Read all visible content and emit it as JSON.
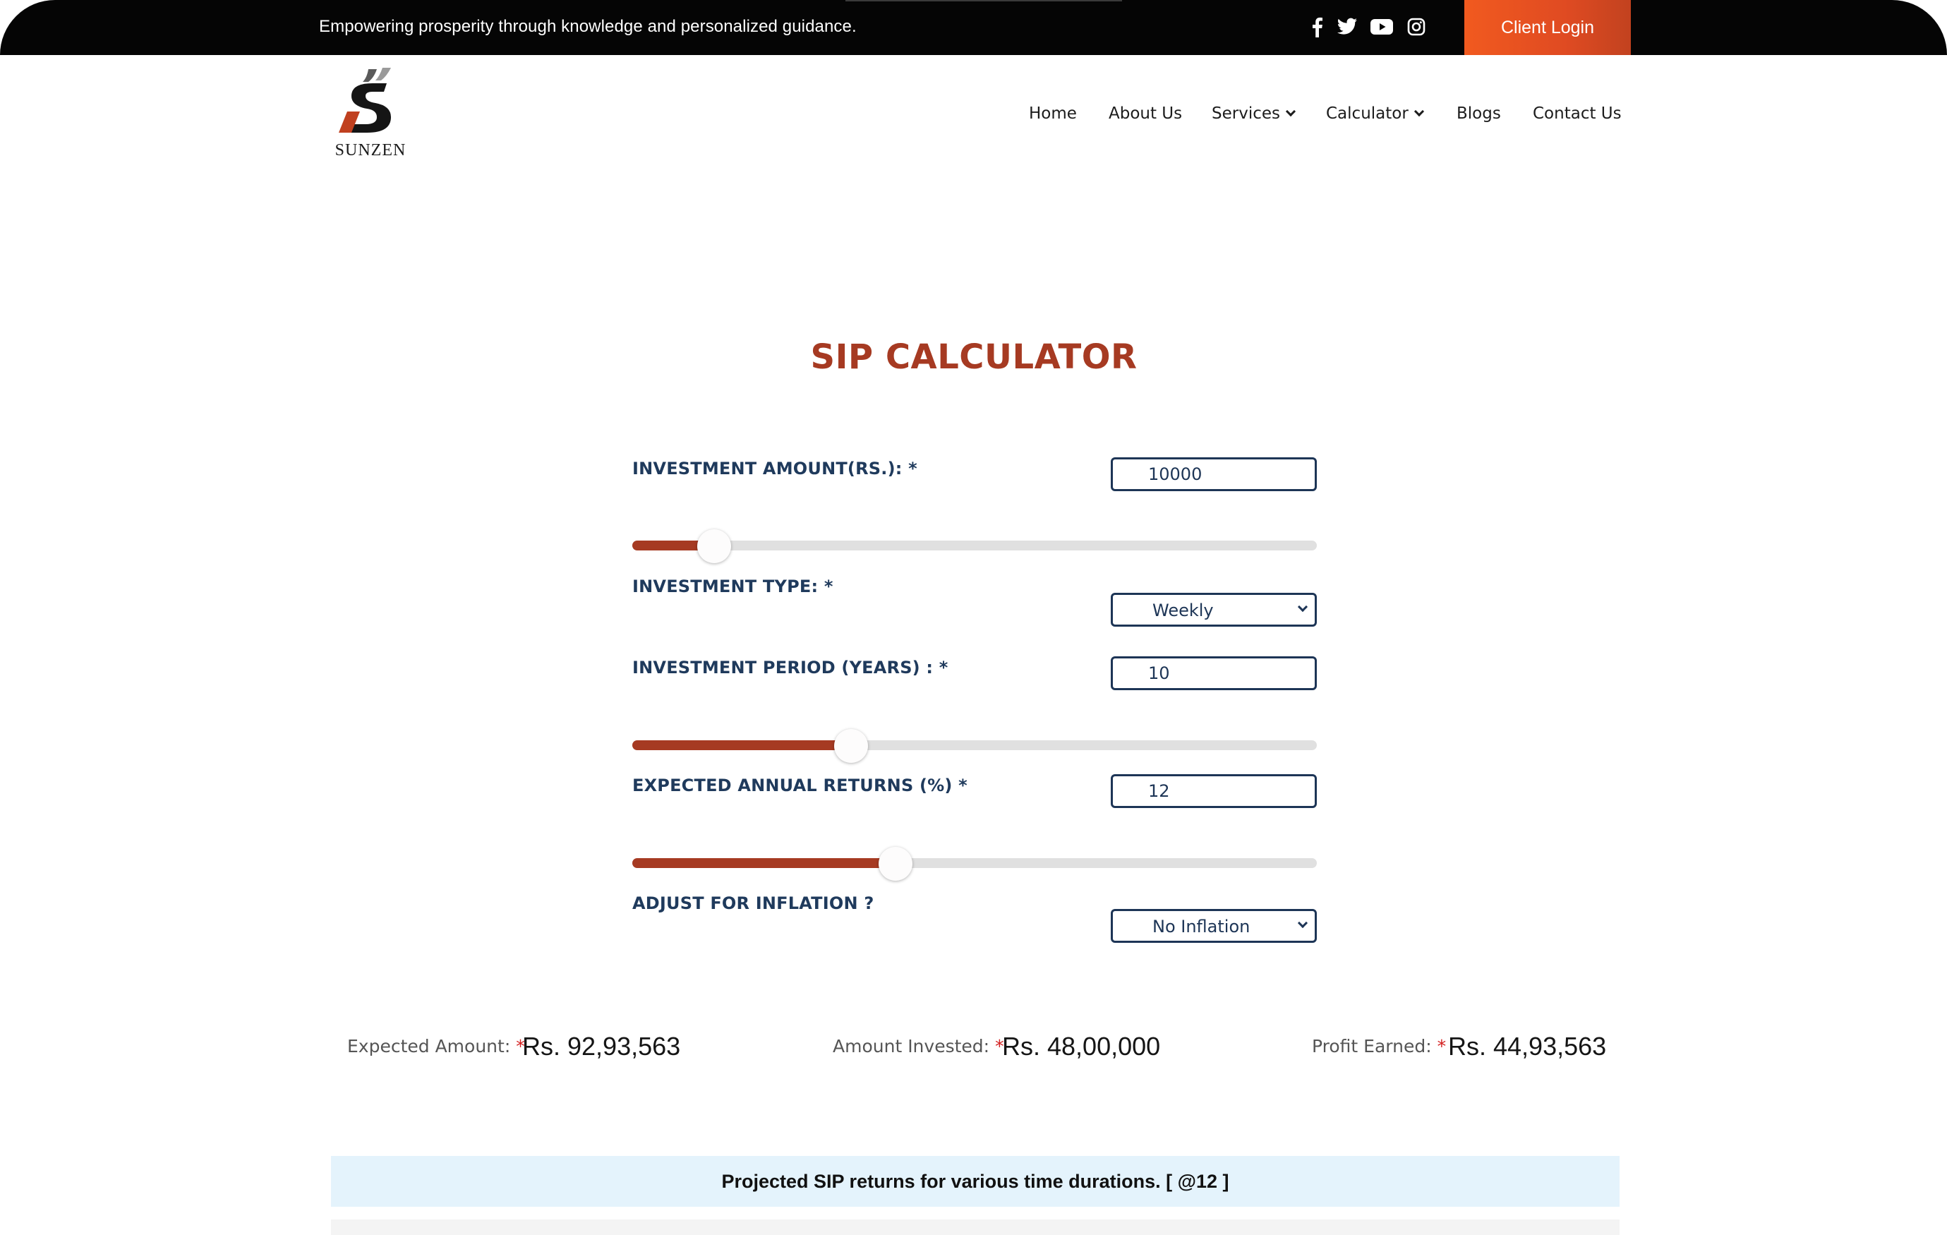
{
  "topbar": {
    "tagline": "Empowering prosperity through knowledge and personalized guidance.",
    "social_icons": [
      "facebook-icon",
      "twitter-icon",
      "youtube-icon",
      "instagram-icon"
    ],
    "login_label": "Client Login",
    "login_color": "#f15a1f"
  },
  "brand": {
    "name": "SUNZEN"
  },
  "nav": {
    "home": "Home",
    "about": "About Us",
    "services": "Services",
    "calculator": "Calculator",
    "blogs": "Blogs",
    "contact": "Contact Us"
  },
  "calculator": {
    "title": "SIP CALCULATOR",
    "amount_label": "INVESTMENT AMOUNT(RS.): *",
    "amount_value": "10000",
    "amount_slider_fraction": 0.12,
    "type_label": "INVESTMENT TYPE: *",
    "type_value": "Weekly",
    "period_label": "INVESTMENT PERIOD (YEARS) : *",
    "period_value": "10",
    "period_slider_fraction": 0.32,
    "returns_label": "EXPECTED ANNUAL RETURNS (%) *",
    "returns_value": "12",
    "returns_slider_fraction": 0.385,
    "inflation_label": "ADJUST FOR INFLATION ?",
    "inflation_value": "No Inflation"
  },
  "results": {
    "expected_label": "Expected Amount:",
    "expected_value": "Rs. 92,93,563",
    "invested_label": "Amount Invested:",
    "invested_value": "Rs. 48,00,000",
    "profit_label": "Profit Earned:",
    "profit_value": "Rs. 44,93,563",
    "required_mark": "*"
  },
  "projection": {
    "heading": "Projected SIP returns for various time durations. [ @12 ]"
  },
  "colors": {
    "accent": "#a63a22",
    "navy": "#1d3556",
    "banner": "#e4f3fc"
  }
}
